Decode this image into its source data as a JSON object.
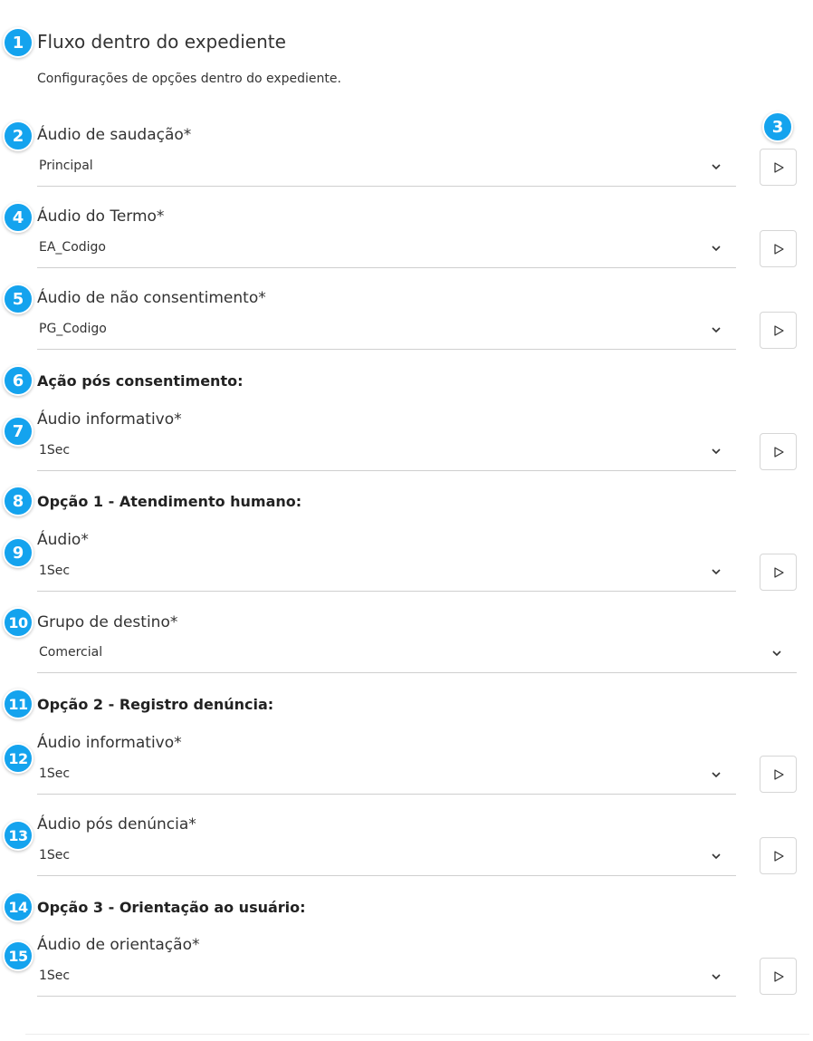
{
  "header": {
    "title": "Fluxo dentro do expediente",
    "subtitle": "Configurações de opções dentro do expediente."
  },
  "badges": [
    "1",
    "2",
    "3",
    "4",
    "5",
    "6",
    "7",
    "8",
    "9",
    "10",
    "11",
    "12",
    "13",
    "14",
    "15"
  ],
  "fields": {
    "audio_saudacao": {
      "label": "Áudio de saudação*",
      "value": "Principal"
    },
    "audio_termo": {
      "label": "Áudio do Termo*",
      "value": "EA_Codigo"
    },
    "audio_nao_consentimento": {
      "label": "Áudio de não consentimento*",
      "value": "PG_Codigo"
    },
    "acao_pos_consentimento": {
      "heading": "Ação pós consentimento:"
    },
    "audio_informativo_1": {
      "label": "Áudio informativo*",
      "value": "1Sec"
    },
    "opcao1": {
      "heading": "Opção 1 - Atendimento humano:"
    },
    "audio_opcao1": {
      "label": "Áudio*",
      "value": "1Sec"
    },
    "grupo_destino": {
      "label": "Grupo de destino*",
      "value": "Comercial"
    },
    "opcao2": {
      "heading": "Opção 2 - Registro denúncia:"
    },
    "audio_informativo_2": {
      "label": "Áudio informativo*",
      "value": "1Sec"
    },
    "audio_pos_denuncia": {
      "label": "Áudio pós denúncia*",
      "value": "1Sec"
    },
    "opcao3": {
      "heading": "Opção 3 - Orientação ao usuário:"
    },
    "audio_orientacao": {
      "label": "Áudio de orientação*",
      "value": "1Sec"
    }
  },
  "icons": {
    "play": "play-icon",
    "chevron": "chevron-down-icon"
  },
  "colors": {
    "badge": "#14a3ee",
    "border": "#cfcfcf"
  }
}
